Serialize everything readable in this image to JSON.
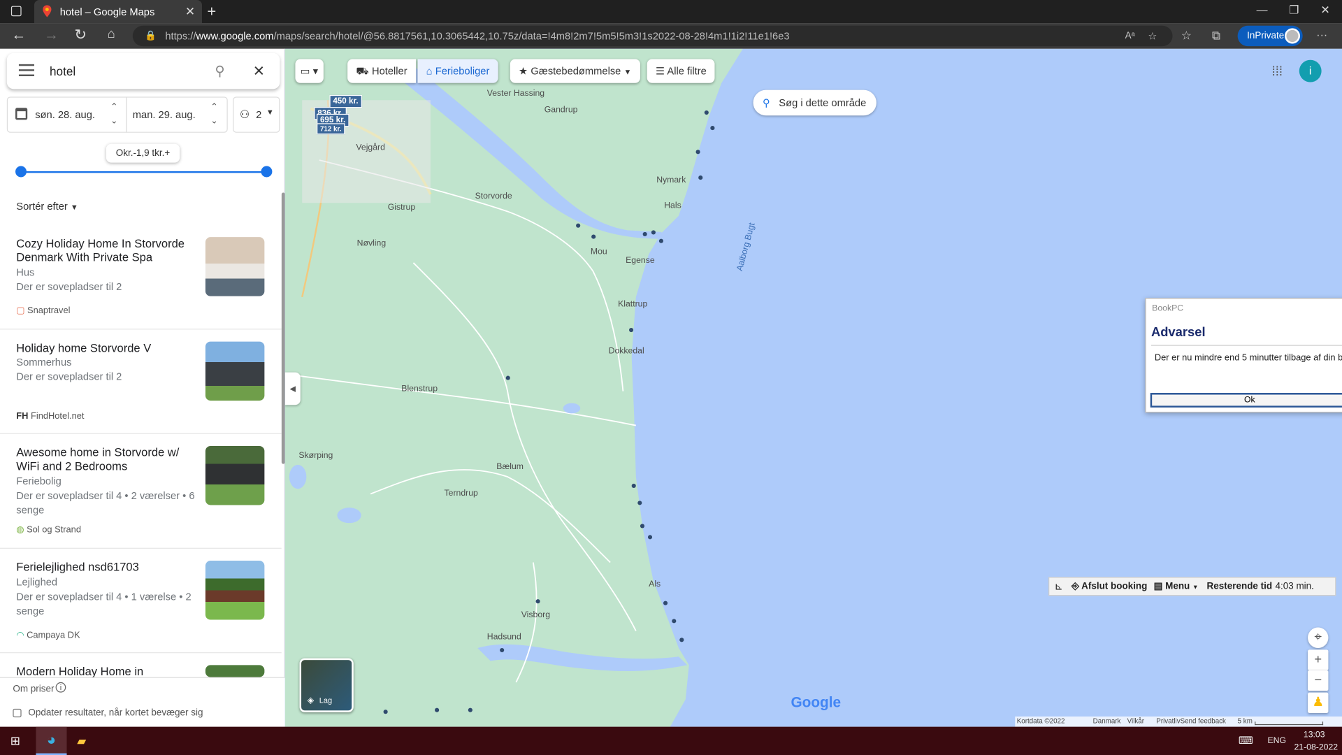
{
  "browser": {
    "tab_title": "hotel – Google Maps",
    "url_prefix": "https://",
    "url_host": "www.google.com",
    "url_path": "/maps/search/hotel/@56.8817561,10.3065442,10.75z/data=!4m8!2m7!5m5!5m3!1s2022-08-28!4m1!1i2!11e1!6e3",
    "inprivate_label": "InPrivate"
  },
  "sidebar": {
    "search_value": "hotel",
    "checkin": "søn. 28. aug.",
    "checkout": "man. 29. aug.",
    "guests": "2",
    "price_tooltip": "Okr.-1,9 tkr.+",
    "sort_label": "Sortér efter",
    "results": [
      {
        "title": "Cozy Holiday Home In Storvorde Denmark With Private Spa",
        "type": "Hus",
        "details": "Der er sovepladser til 2",
        "source": "Snaptravel"
      },
      {
        "title": "Holiday home Storvorde V",
        "type": "Sommerhus",
        "details": "Der er sovepladser til 2",
        "source": "FindHotel.net"
      },
      {
        "title": "Awesome home in Storvorde w/ WiFi and 2 Bedrooms",
        "type": "Feriebolig",
        "details": "Der er sovepladser til 4 • 2 værelser • 6 senge",
        "source": "Sol og Strand"
      },
      {
        "title": "Ferielejlighed nsd61703",
        "type": "Lejlighed",
        "details": "Der er sovepladser til 4 • 1 værelse • 2 senge",
        "source": "Campaya DK"
      },
      {
        "title": "Modern Holiday Home in",
        "type": "",
        "details": "",
        "source": ""
      }
    ],
    "about_prices": "Om priser",
    "update_checkbox_label": "Opdater resultater, når kortet bevæger sig"
  },
  "map": {
    "chips": {
      "hotels": "Hoteller",
      "vacation": "Ferieboliger",
      "rating": "Gæstebedømmelse",
      "filters": "Alle filtre"
    },
    "search_area": "Søg i dette område",
    "price_tags": [
      "450 kr.",
      "836 kr.",
      "695 kr.",
      "712 kr."
    ],
    "places": [
      "Vester Hassing",
      "Gandrup",
      "Vejgård",
      "Nymark",
      "Storvorde",
      "Gistrup",
      "Hals",
      "Nøvling",
      "Mou",
      "Egense",
      "Klattrup",
      "Dokkedal",
      "Blenstrup",
      "Skørping",
      "Bælum",
      "Terndrup",
      "Als",
      "Visborg",
      "Hadsund",
      "Aalborg Bugt"
    ],
    "layers_label": "Lag",
    "footer": {
      "data": "Kortdata ©2022",
      "country": "Danmark",
      "terms": "Vilkår",
      "privacy": "Privatliv",
      "feedback": "Send feedback",
      "scale": "5 km"
    },
    "logo": "Google"
  },
  "dialog": {
    "app": "BookPC",
    "title": "Advarsel",
    "message": "Der er nu mindre end 5 minutter tilbage af din bo",
    "ok": "Ok"
  },
  "bookbar": {
    "end": "Afslut booking",
    "menu": "Menu",
    "remaining_label": "Resterende tid",
    "remaining_value": "4:03 min."
  },
  "taskbar": {
    "lang": "ENG",
    "time": "13:03",
    "date": "21-08-2022"
  }
}
